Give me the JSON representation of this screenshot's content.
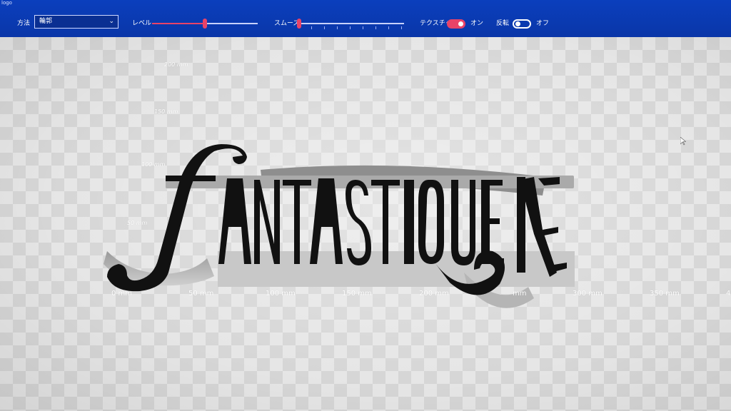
{
  "window": {
    "title": "logo"
  },
  "toolbar": {
    "method_label": "方法",
    "method_value": "輪郭",
    "level_label": "レベル",
    "level_value": 0.5,
    "smooth_label": "スムーズ",
    "smooth_value": 0.0,
    "texture_label": "テクスチャ",
    "texture_state": "オン",
    "invert_label": "反転",
    "invert_state": "オフ"
  },
  "colors": {
    "toolbar_bg": "#0b3fbd",
    "accent": "#e84368",
    "logo_fill": "#111111"
  },
  "canvas": {
    "logo_text": "FANTASTIQUE",
    "x_axis": [
      "0 mm",
      "50 mm",
      "100 mm",
      "150 mm",
      "200 mm",
      "mm",
      "300 mm",
      "350 mm",
      "4"
    ],
    "y_axis": [
      "200 mm",
      "150 mm",
      "100 mm",
      "50 mm"
    ]
  }
}
